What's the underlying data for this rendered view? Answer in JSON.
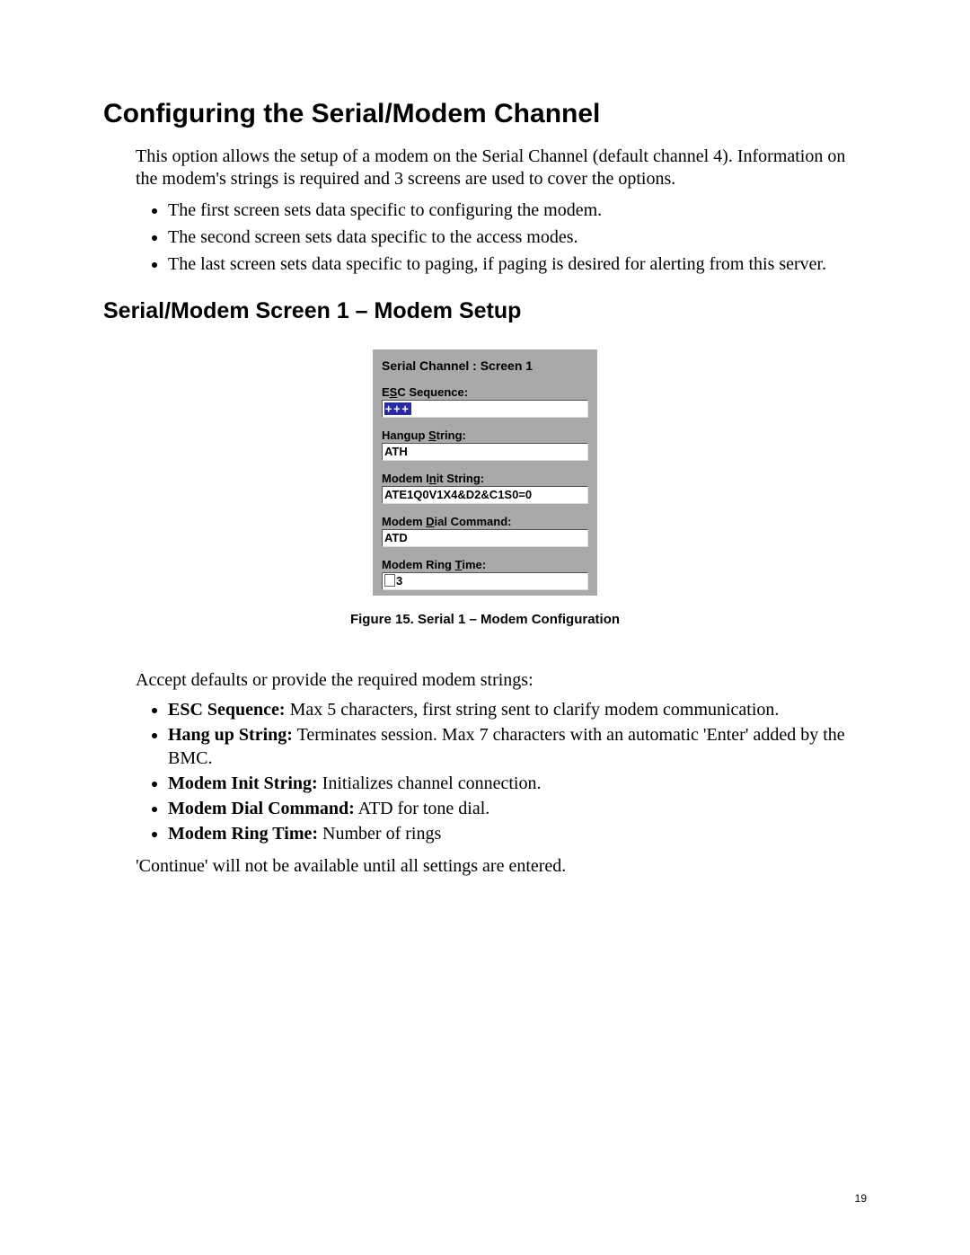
{
  "heading": "Configuring the Serial/Modem Channel",
  "intro": "This option allows the setup of a modem on the Serial Channel (default channel 4).  Information on the modem's strings is required and 3 screens are used to cover the options.",
  "intro_bullets": [
    "The first screen sets data specific to configuring the modem.",
    "The second screen sets data specific to the access modes.",
    "The last screen sets data specific to paging, if paging is desired for alerting from this server."
  ],
  "subheading": "Serial/Modem Screen 1 – Modem Setup",
  "dialog": {
    "title": "Serial Channel : Screen 1",
    "fields": {
      "esc": {
        "label_pre": "E",
        "label_u": "S",
        "label_post": "C Sequence:",
        "value": "+++"
      },
      "hangup": {
        "label_pre": "Hangup ",
        "label_u": "S",
        "label_post": "tring:",
        "value": "ATH"
      },
      "init": {
        "label_pre": "Modem I",
        "label_u": "n",
        "label_post": "it String:",
        "value": "ATE1Q0V1X4&D2&C1S0=0"
      },
      "dial": {
        "label_pre": "Modem ",
        "label_u": "D",
        "label_post": "ial Command:",
        "value": "ATD"
      },
      "ring": {
        "label_pre": "Modem Ring ",
        "label_u": "T",
        "label_post": "ime:",
        "value": "3"
      }
    }
  },
  "caption": "Figure 15.  Serial 1 – Modem Configuration",
  "accept_line": "Accept defaults or provide the required modem strings:",
  "definitions": [
    {
      "term": "ESC Sequence:",
      "desc": "  Max 5 characters, first string sent to clarify modem communication."
    },
    {
      "term": "Hang up String:",
      "desc": "  Terminates session. Max 7 characters with an automatic 'Enter' added by the BMC."
    },
    {
      "term": "Modem Init String:",
      "desc": "  Initializes channel connection."
    },
    {
      "term": "Modem Dial Command:",
      "desc": "  ATD for tone dial."
    },
    {
      "term": "Modem Ring Time:",
      "desc": " Number of rings"
    }
  ],
  "continue_line": "'Continue' will not be available until all settings are entered.",
  "page_number": "19"
}
